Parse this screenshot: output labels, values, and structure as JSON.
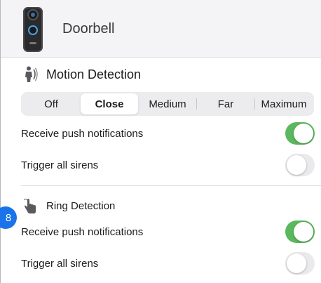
{
  "device": {
    "name": "Doorbell",
    "image_icon": "doorbell-device-image"
  },
  "motion": {
    "icon": "motion-person-icon",
    "title": "Motion Detection",
    "sensitivity": {
      "options": [
        "Off",
        "Close",
        "Medium",
        "Far",
        "Maximum"
      ],
      "selected": "Close"
    },
    "push_label": "Receive push notifications",
    "push_on": true,
    "sirens_label": "Trigger all sirens",
    "sirens_on": false
  },
  "ring": {
    "icon": "finger-press-icon",
    "title": "Ring Detection",
    "push_label": "Receive push notifications",
    "push_on": true,
    "sirens_label": "Trigger all sirens",
    "sirens_on": false
  },
  "step_badge": "8",
  "colors": {
    "toggle_on": "#5bb85d",
    "toggle_off": "#eaeaec",
    "badge": "#1a73e8"
  }
}
